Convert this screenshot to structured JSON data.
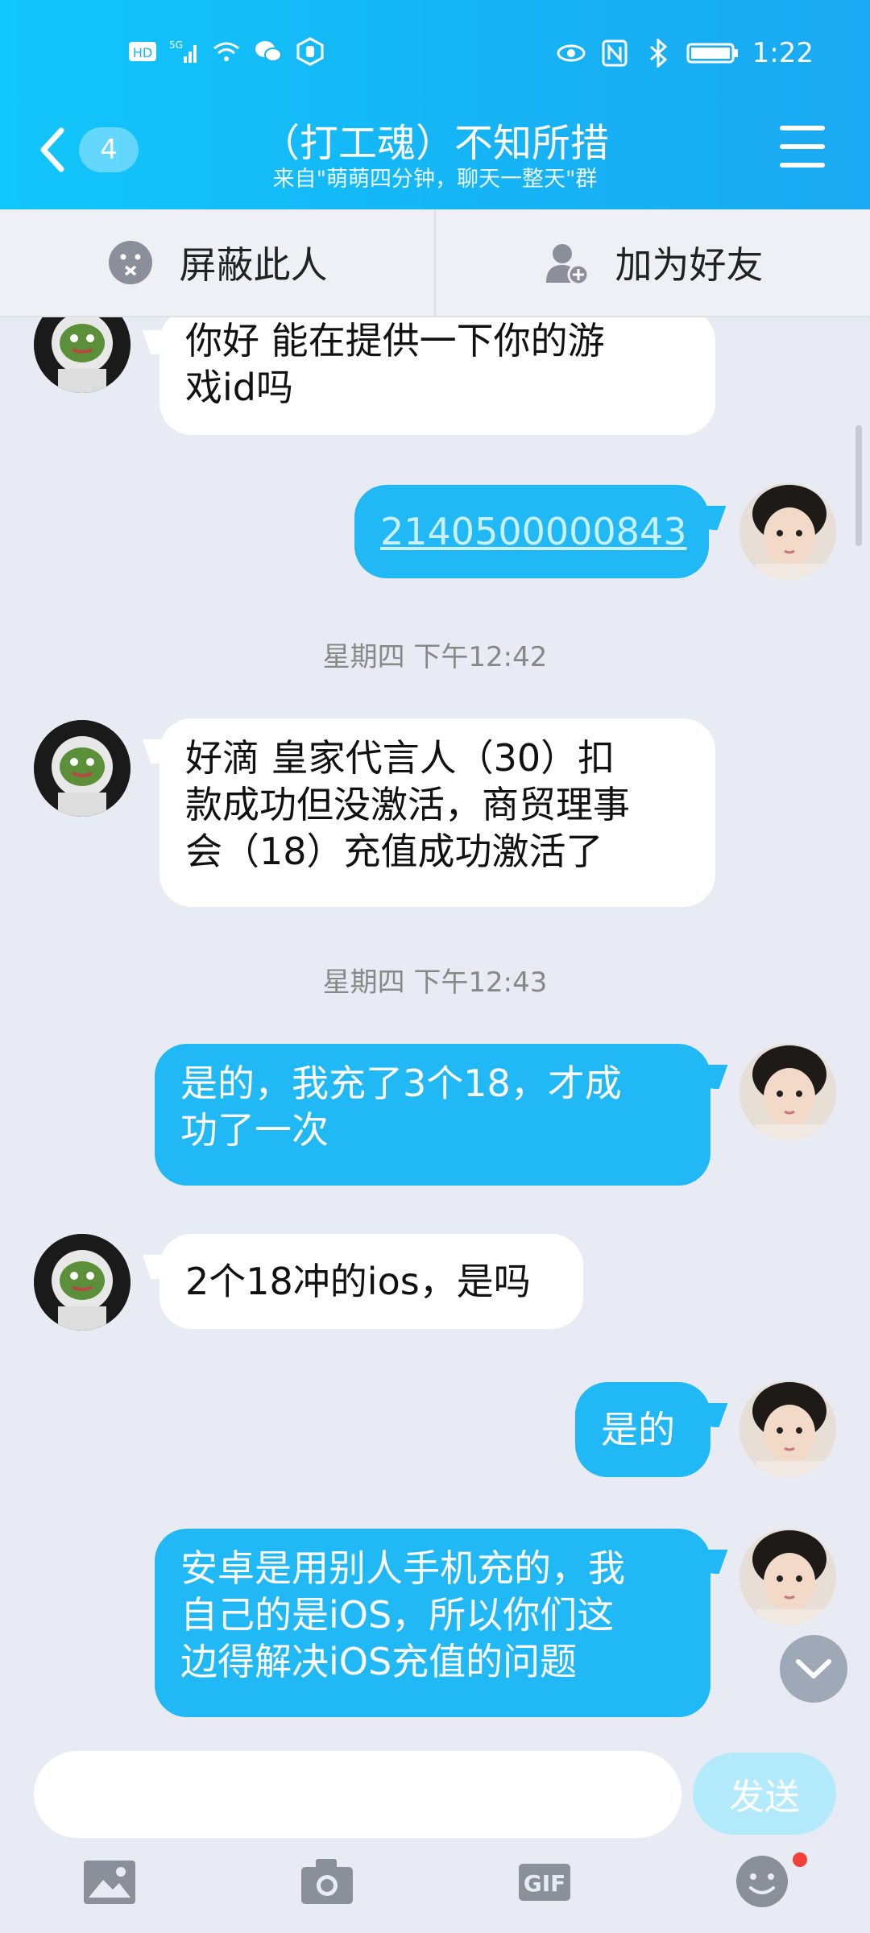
{
  "status_bar": {
    "time": "1:22",
    "left_icons": [
      "hd-icon",
      "5g-signal-icon",
      "wifi-icon",
      "wechat-icon",
      "hand-icon"
    ],
    "right_icons": [
      "eye-icon",
      "nfc-icon",
      "bluetooth-icon",
      "battery-icon"
    ]
  },
  "header": {
    "back_badge": "4",
    "title": "（打工魂）不知所措",
    "subtitle": "来自\"萌萌四分钟，聊天一整天\"群"
  },
  "actions": {
    "block_label": "屏蔽此人",
    "add_friend_label": "加为好友"
  },
  "messages": [
    {
      "side": "in",
      "text_lines": [
        "你好 能在提供一下你的游",
        "戏id吗"
      ]
    },
    {
      "side": "out",
      "text": "2140500000843",
      "is_link": true
    },
    {
      "timestamp": "星期四 下午12:42"
    },
    {
      "side": "in",
      "text_lines": [
        "好滴 皇家代言人（30）扣",
        "款成功但没激活，商贸理事",
        "会（18）充值成功激活了"
      ]
    },
    {
      "timestamp": "星期四 下午12:43"
    },
    {
      "side": "out",
      "text_lines": [
        "是的，我充了3个18，才成",
        "功了一次"
      ]
    },
    {
      "side": "in",
      "text": "2个18冲的ios，是吗"
    },
    {
      "side": "out",
      "text": "是的"
    },
    {
      "side": "out",
      "text_lines": [
        "安卓是用别人手机充的，我",
        "自己的是iOS，所以你们这",
        "边得解决iOS充值的问题"
      ]
    }
  ],
  "input": {
    "placeholder": "",
    "send_label": "发送"
  },
  "toolbar": {
    "icons": [
      "image-icon",
      "camera-icon",
      "gif-icon",
      "emoji-icon"
    ],
    "gif_label": "GIF"
  },
  "colors": {
    "header_start": "#11c6fb",
    "outgoing_bubble": "#21b8f6",
    "send_button": "#b3ebfc",
    "background": "#e8ebf3"
  }
}
